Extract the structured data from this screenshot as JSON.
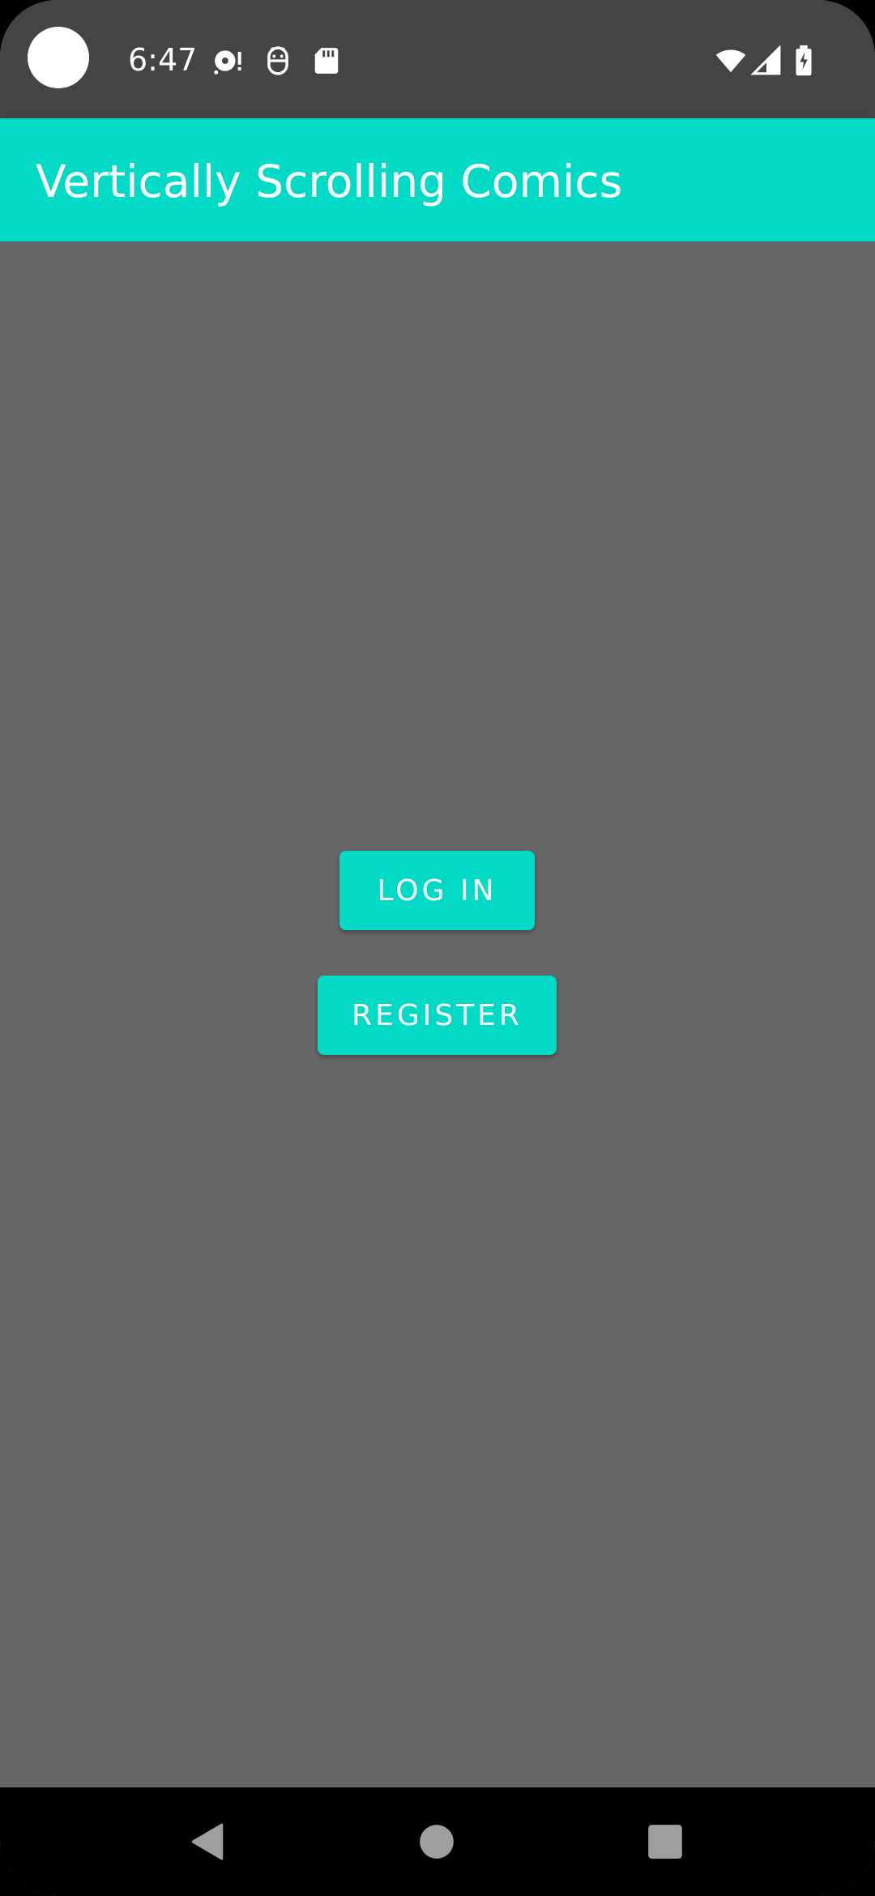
{
  "status_bar": {
    "time": "6:47",
    "icons": [
      "camera-cutout",
      "media-alert-icon",
      "android-debug-icon",
      "sd-card-icon",
      "wifi-icon",
      "cell-signal-icon",
      "battery-charging-icon"
    ]
  },
  "app_bar": {
    "title": "Vertically Scrolling Comics",
    "color": "#03dac5"
  },
  "main": {
    "login_label": "LOG IN",
    "register_label": "REGISTER",
    "background": "#666666"
  },
  "nav_bar": {
    "icons": [
      "back-icon",
      "home-icon",
      "recents-icon"
    ]
  }
}
